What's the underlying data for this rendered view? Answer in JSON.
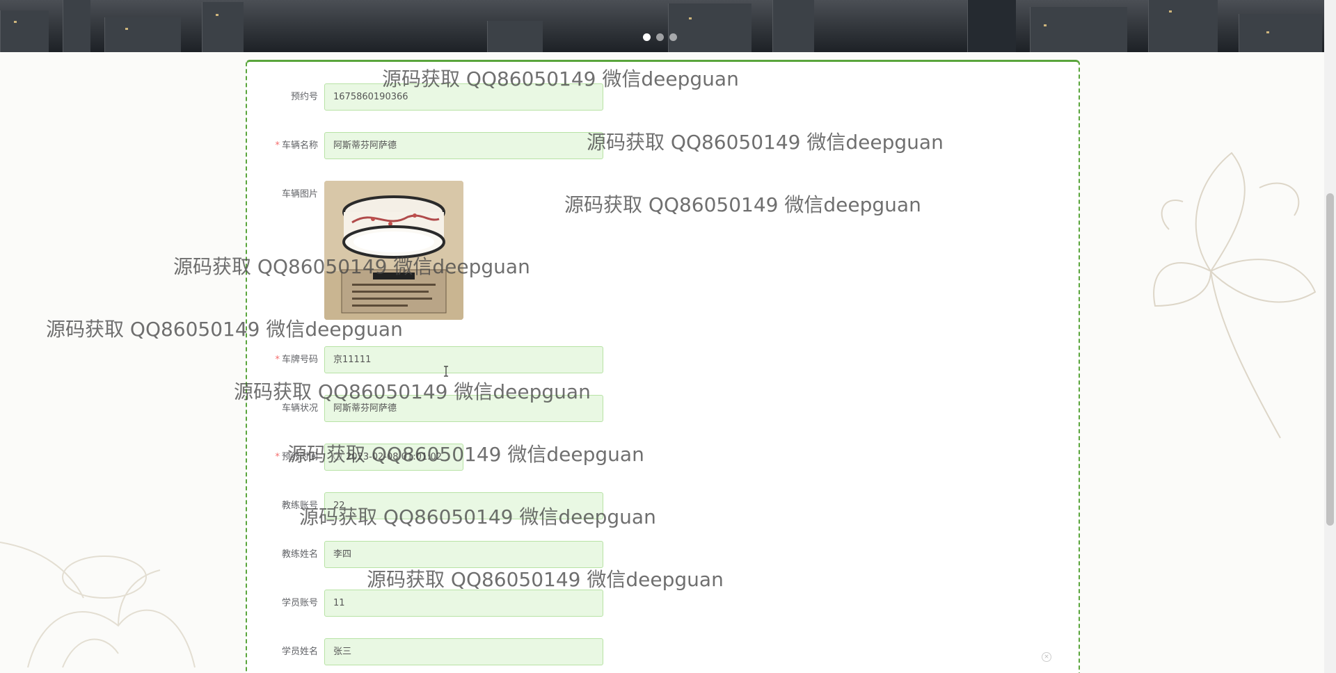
{
  "banner": {
    "dots": 3,
    "active_dot": 0
  },
  "form": {
    "rows": [
      {
        "label": "预约号",
        "required": false,
        "value": "1675860190366"
      },
      {
        "label": "车辆名称",
        "required": true,
        "value": "阿斯蒂芬阿萨德"
      },
      {
        "label": "车辆图片",
        "required": false,
        "value": ""
      },
      {
        "label": "车牌号码",
        "required": true,
        "value": "京11111"
      },
      {
        "label": "车辆状况",
        "required": false,
        "value": "阿斯蒂芬阿萨德"
      },
      {
        "label": "预约时间",
        "required": true,
        "value": "2023-02-08 01:01:02"
      },
      {
        "label": "教练账号",
        "required": false,
        "value": "22"
      },
      {
        "label": "教练姓名",
        "required": false,
        "value": "李四"
      },
      {
        "label": "学员账号",
        "required": false,
        "value": "11"
      },
      {
        "label": "学员姓名",
        "required": false,
        "value": "张三"
      }
    ],
    "image_icon": "lamp-product-image"
  },
  "watermark_text": "源码获取 QQ86050149 微信deepguan",
  "colors": {
    "accent": "#5aa53c",
    "field_bg": "#e9f8e3",
    "required": "#f56c6c"
  }
}
